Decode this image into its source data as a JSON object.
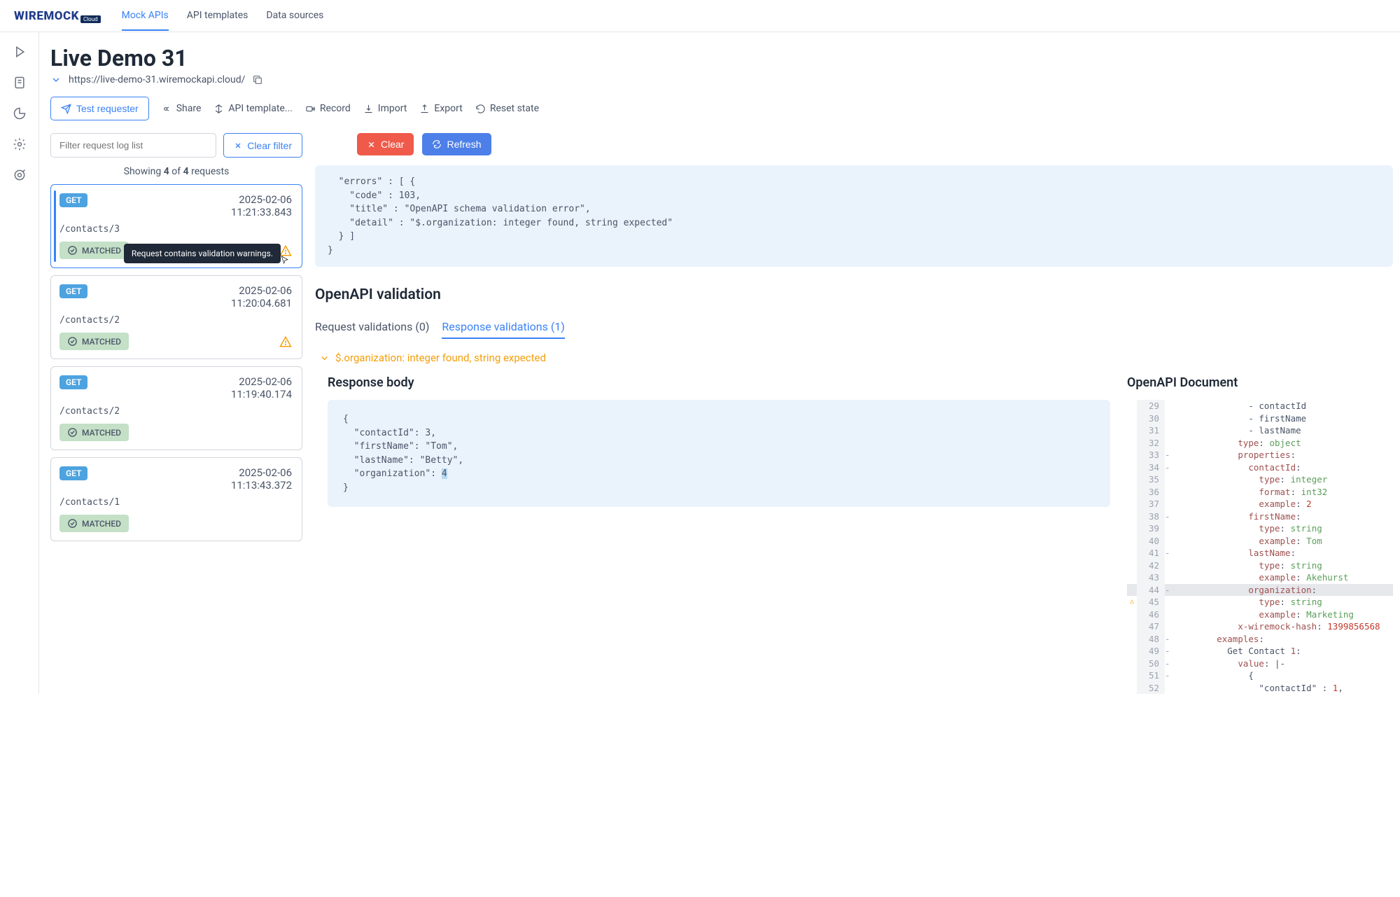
{
  "nav": {
    "logo_text": "WIREMOCK",
    "logo_badge": "Cloud",
    "tabs": [
      "Mock APIs",
      "API templates",
      "Data sources"
    ],
    "active_tab": 0
  },
  "page": {
    "title": "Live Demo 31",
    "url": "https://live-demo-31.wiremockapi.cloud/"
  },
  "toolbar": {
    "test_requester": "Test requester",
    "share": "Share",
    "api_template": "API template...",
    "record": "Record",
    "import": "Import",
    "export": "Export",
    "reset_state": "Reset state"
  },
  "filter": {
    "placeholder": "Filter request log list",
    "clear_filter": "Clear filter",
    "showing_prefix": "Showing",
    "showing_count": "4",
    "showing_of": "of",
    "showing_total": "4",
    "showing_suffix": "requests"
  },
  "tooltip": "Request contains validation warnings.",
  "logs": [
    {
      "method": "GET",
      "path": "/contacts/3",
      "date": "2025-02-06",
      "time": "11:21:33.843",
      "status": "MATCHED",
      "warning": true,
      "selected": true
    },
    {
      "method": "GET",
      "path": "/contacts/2",
      "date": "2025-02-06",
      "time": "11:20:04.681",
      "status": "MATCHED",
      "warning": true,
      "selected": false
    },
    {
      "method": "GET",
      "path": "/contacts/2",
      "date": "2025-02-06",
      "time": "11:19:40.174",
      "status": "MATCHED",
      "warning": false,
      "selected": false
    },
    {
      "method": "GET",
      "path": "/contacts/1",
      "date": "2025-02-06",
      "time": "11:13:43.372",
      "status": "MATCHED",
      "warning": false,
      "selected": false
    }
  ],
  "actions": {
    "clear": "Clear",
    "refresh": "Refresh"
  },
  "error_block": "  \"errors\" : [ {\n    \"code\" : 103,\n    \"title\" : \"OpenAPI schema validation error\",\n    \"detail\" : \"$.organization: integer found, string expected\"\n  } ]\n}",
  "validation": {
    "title": "OpenAPI validation",
    "request_tab": "Request validations (0)",
    "response_tab": "Response validations (1)",
    "message": "$.organization: integer found, string expected"
  },
  "response_body": {
    "title": "Response body",
    "content_pre": "{\n  \"contactId\": 3,\n  \"firstName\": \"Tom\",\n  \"lastName\": \"Betty\",\n  \"organization\": ",
    "content_hl": "4",
    "content_post": "\n}"
  },
  "openapi_doc": {
    "title": "OpenAPI Document",
    "lines": [
      {
        "n": "29",
        "fold": "",
        "warn": "",
        "txt": "              - contactId"
      },
      {
        "n": "30",
        "fold": "",
        "warn": "",
        "txt": "              - firstName"
      },
      {
        "n": "31",
        "fold": "",
        "warn": "",
        "txt": "              - lastName"
      },
      {
        "n": "32",
        "fold": "",
        "warn": "",
        "txt": "            type: object"
      },
      {
        "n": "33",
        "fold": "-",
        "warn": "",
        "txt": "            properties:"
      },
      {
        "n": "34",
        "fold": "-",
        "warn": "",
        "txt": "              contactId:"
      },
      {
        "n": "35",
        "fold": "",
        "warn": "",
        "txt": "                type: integer"
      },
      {
        "n": "36",
        "fold": "",
        "warn": "",
        "txt": "                format: int32"
      },
      {
        "n": "37",
        "fold": "",
        "warn": "",
        "txt": "                example: 2"
      },
      {
        "n": "38",
        "fold": "-",
        "warn": "",
        "txt": "              firstName:"
      },
      {
        "n": "39",
        "fold": "",
        "warn": "",
        "txt": "                type: string"
      },
      {
        "n": "40",
        "fold": "",
        "warn": "",
        "txt": "                example: Tom"
      },
      {
        "n": "41",
        "fold": "-",
        "warn": "",
        "txt": "              lastName:"
      },
      {
        "n": "42",
        "fold": "",
        "warn": "",
        "txt": "                type: string"
      },
      {
        "n": "43",
        "fold": "",
        "warn": "",
        "txt": "                example: Akehurst"
      },
      {
        "n": "44",
        "fold": "-",
        "warn": "",
        "hl": true,
        "txt": "              organization:"
      },
      {
        "n": "45",
        "fold": "",
        "warn": "⚠",
        "txt": "                type: string"
      },
      {
        "n": "46",
        "fold": "",
        "warn": "",
        "txt": "                example: Marketing"
      },
      {
        "n": "47",
        "fold": "",
        "warn": "",
        "txt": "            x-wiremock-hash: 1399856568"
      },
      {
        "n": "48",
        "fold": "-",
        "warn": "",
        "txt": "        examples:"
      },
      {
        "n": "49",
        "fold": "-",
        "warn": "",
        "txt": "          Get Contact 1:"
      },
      {
        "n": "50",
        "fold": "-",
        "warn": "",
        "txt": "            value: |-"
      },
      {
        "n": "51",
        "fold": "-",
        "warn": "",
        "txt": "              {"
      },
      {
        "n": "52",
        "fold": "",
        "warn": "",
        "txt": "                \"contactId\" : 1,"
      }
    ]
  }
}
